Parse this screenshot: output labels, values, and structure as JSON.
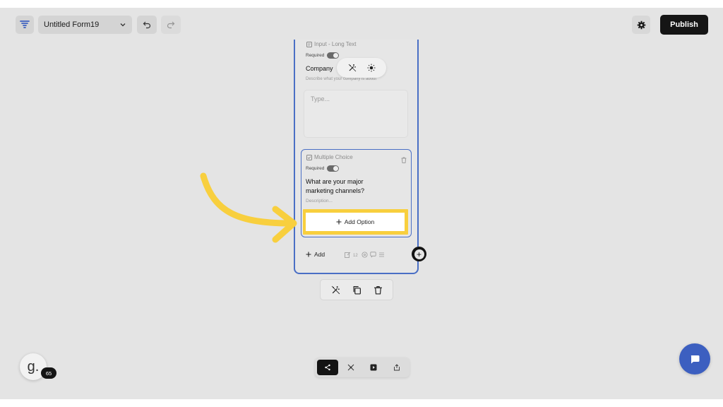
{
  "topbar": {
    "form_name": "Untitled Form19",
    "publish_label": "Publish",
    "icons": [
      "logo-icon",
      "chevron-down-icon",
      "undo-icon",
      "redo-icon",
      "gear-icon"
    ]
  },
  "question1": {
    "type_label": "Input - Long Text",
    "required_label": "Required",
    "title": "Company",
    "description": "Describe what your company is about",
    "placeholder": "Type..."
  },
  "question2": {
    "type_label": "Multiple Choice",
    "required_label": "Required",
    "title": "What are your major marketing channels?",
    "description_placeholder": "Description..."
  },
  "add_option_label": "Add Option",
  "add_label": "Add",
  "badge_count": "65",
  "avatar_letter": "g.",
  "colors": {
    "accent": "#4a6fc5",
    "highlight": "#f8cf3e",
    "publish": "#151515",
    "chat": "#3c5fc0",
    "backdrop": "#e4e4e4"
  }
}
